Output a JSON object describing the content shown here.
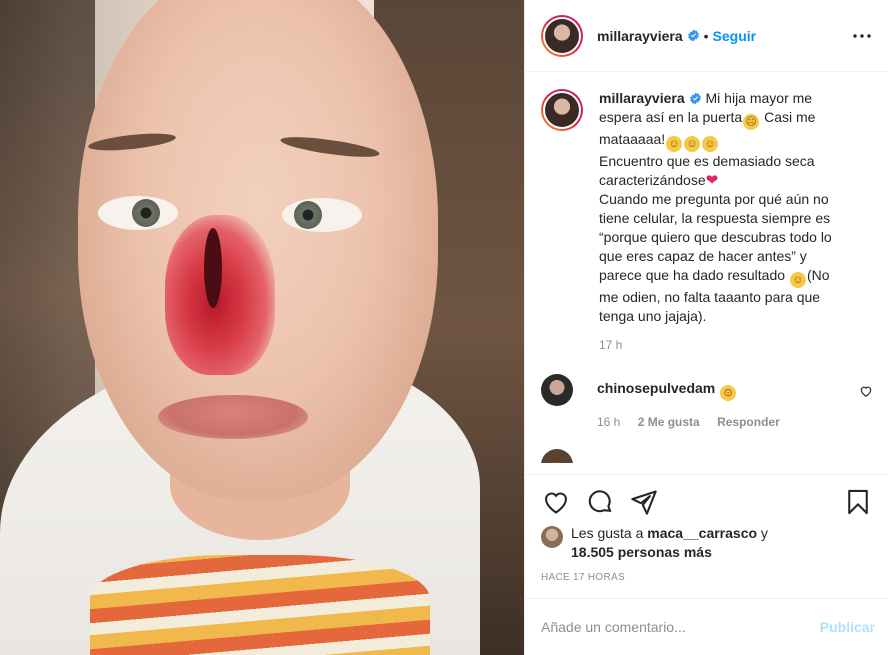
{
  "header": {
    "username": "millarayviera",
    "separator": "•",
    "follow_label": "Seguir",
    "verified_icon": "verified-badge-icon",
    "more_icon": "more-options-icon"
  },
  "caption": {
    "username": "millarayviera",
    "line1": " Mi hija mayor me espera así en la puerta",
    "line2": " Casi me mataaaaa!",
    "line3": "Encuentro que es demasiado seca caracterizándose",
    "line4": "Cuando me pregunta por qué aún no tiene celular, la respuesta siempre es “porque quiero que descubras todo lo que eres capaz de hacer antes” y parece que ha dado resultado",
    "line5": "(No me odien, no falta taaanto para que tenga uno jajaja).",
    "time": "17 h"
  },
  "comment": {
    "username": "chinosepulvedam",
    "time": "16 h",
    "likes": "2 Me gusta",
    "reply": "Responder"
  },
  "actions": {
    "like_icon": "heart-icon",
    "comment_icon": "comment-icon",
    "share_icon": "share-icon",
    "save_icon": "bookmark-icon"
  },
  "likes": {
    "prefix": "Les gusta a ",
    "user": "maca__carrasco",
    "middle": " y ",
    "count": "18.505 personas más"
  },
  "timestamp": "Hace 17 horas",
  "add_comment": {
    "placeholder": "Añade un comentario...",
    "publish_label": "Publicar"
  },
  "colors": {
    "accent": "#0095f6",
    "publish_disabled": "#b2dffc",
    "muted": "#8e8e8e",
    "text": "#262626"
  }
}
